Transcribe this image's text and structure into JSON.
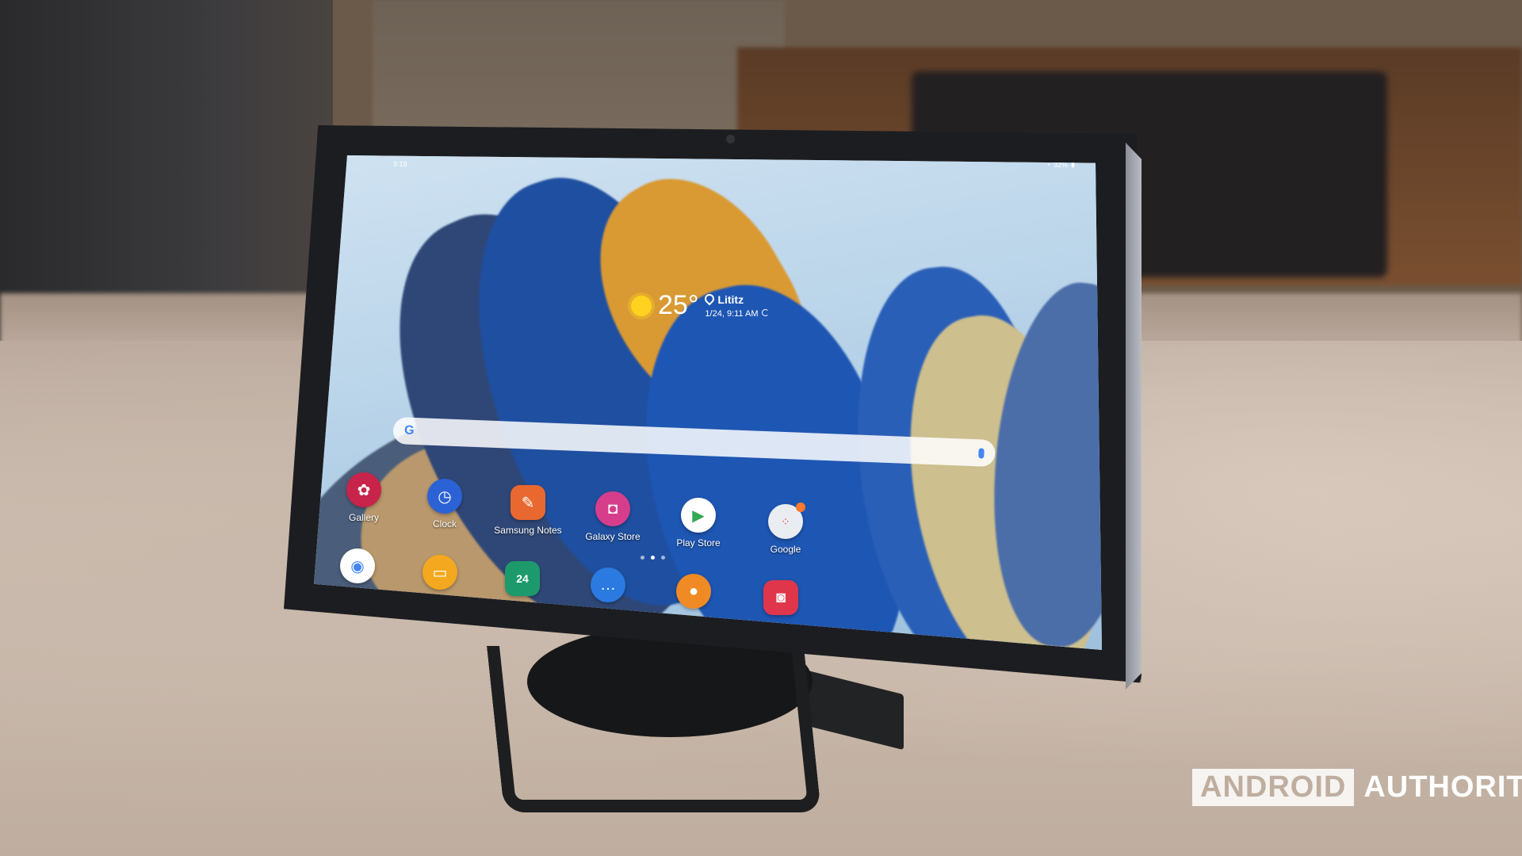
{
  "scene": {
    "description_kind": "photo-of-tablet-on-stand"
  },
  "tablet": {
    "status_bar": {
      "time": "9:19",
      "battery": "32%"
    },
    "weather": {
      "temperature": "25°",
      "location": "Lititz",
      "datetime": "1/24, 9:11 AM",
      "icon": "sun-icon"
    },
    "search": {
      "g_logo": "G",
      "mic_icon": "mic-icon"
    },
    "apps_row1": [
      {
        "label": "Gallery",
        "icon": "gallery-icon",
        "color": "#c8234a"
      },
      {
        "label": "Clock",
        "icon": "clock-icon",
        "color": "#2b62d6"
      },
      {
        "label": "Samsung Notes",
        "icon": "notes-icon",
        "color": "#e8682f"
      },
      {
        "label": "Galaxy Store",
        "icon": "store-icon",
        "color": "#d63e8b"
      },
      {
        "label": "Play Store",
        "icon": "play-icon",
        "color": "#ffffff"
      },
      {
        "label": "Google",
        "icon": "google-folder-icon",
        "color": "#e9edf2"
      }
    ],
    "apps_row2": [
      {
        "icon": "chrome-icon",
        "color": "#ffffff"
      },
      {
        "icon": "files-icon",
        "color": "#f3a81f"
      },
      {
        "label": "24",
        "icon": "calendar-icon",
        "color": "#1d9a6c"
      },
      {
        "icon": "messages-icon",
        "color": "#2a7ae2"
      },
      {
        "icon": "contacts-icon",
        "color": "#f08a24"
      },
      {
        "icon": "camera-icon",
        "color": "#e0364c"
      }
    ]
  },
  "watermark": {
    "boxed": "ANDROID",
    "text": "AUTHORITY"
  }
}
